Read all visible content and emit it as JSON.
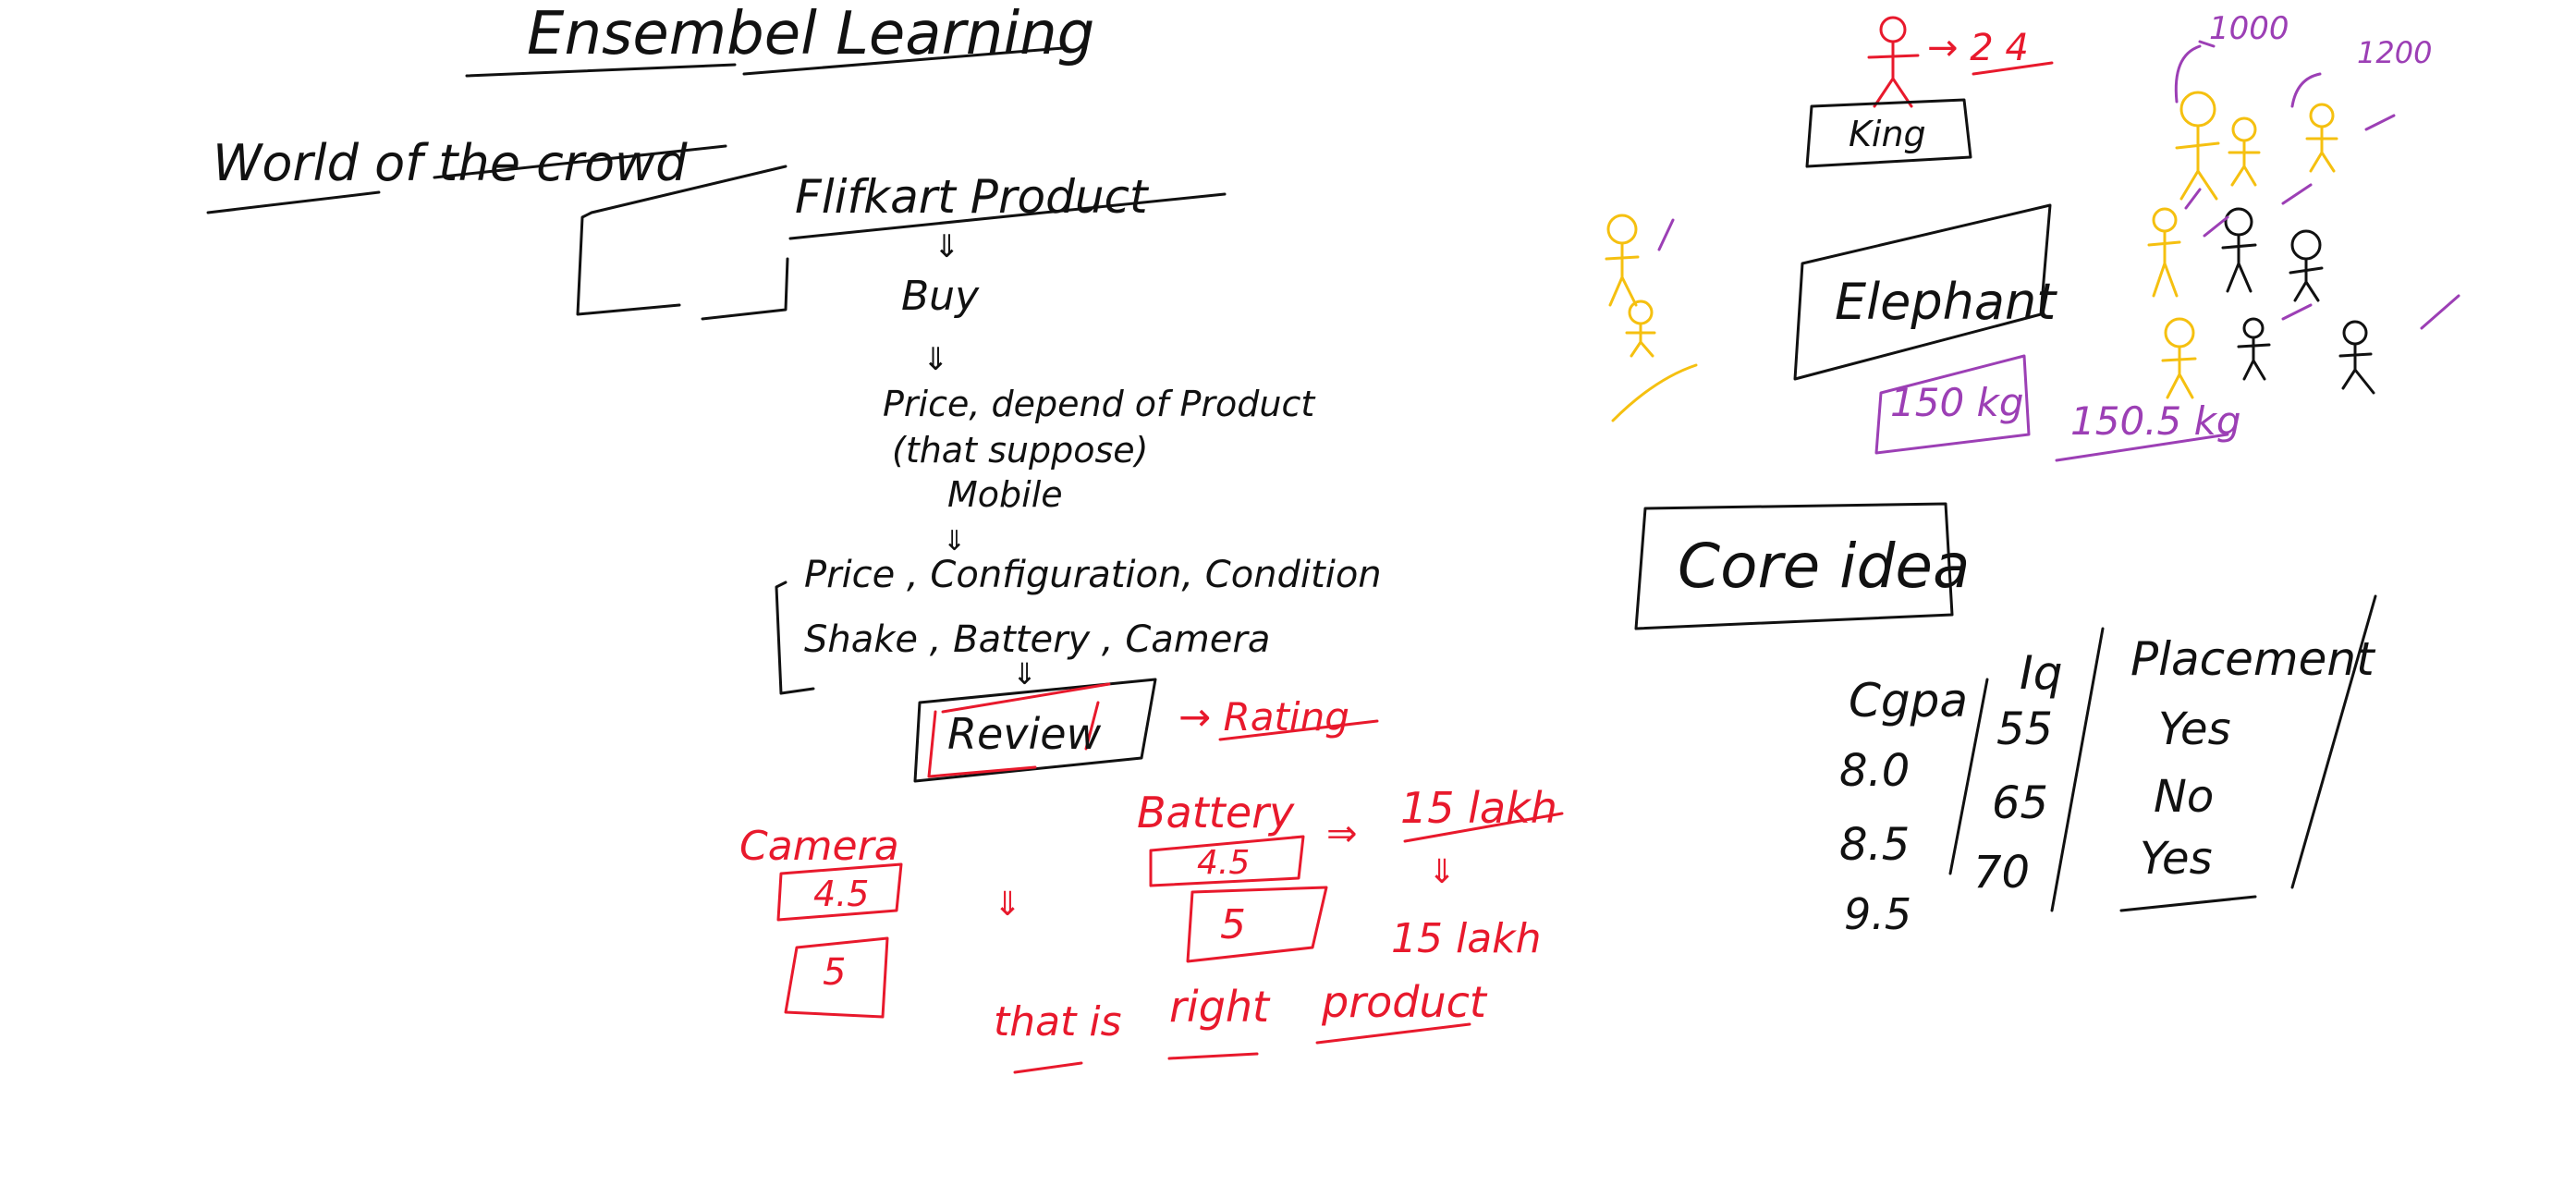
{
  "left": {
    "title": "Ensembel Learning",
    "subtitle": "World of the crowd",
    "product": "Flifkart Product",
    "buy": "Buy",
    "price_line1": "Price, depend of Product",
    "price_line2": "(that suppose)",
    "mobile": "Mobile",
    "features_line1": "Price , Configuration, Condition",
    "features_line2": "Shake , Battery , Camera",
    "review": "Review",
    "rating": "→ Rating",
    "camera": "Camera",
    "camera_rating": "4.5",
    "camera_rating2": "5",
    "battery": "Battery",
    "battery_rating": "4.5",
    "battery_rating2": "5",
    "price1": "15 lakh",
    "price2": "15 lakh",
    "conclusion_1": "that is",
    "conclusion_2": "right",
    "conclusion_3": "product"
  },
  "right": {
    "king": "King",
    "count": "→ 2 4",
    "count_1000": "1000",
    "count_1200": "1200",
    "elephant": "Elephant",
    "weight_guess": "150 kg",
    "weight_crowd": "150.5 kg",
    "core_idea": "Core idea",
    "table": {
      "headers": [
        "Cgpa",
        "Iq",
        "Placement"
      ],
      "rows": [
        [
          "8.0",
          "55",
          "Yes"
        ],
        [
          "8.5",
          "65",
          "No"
        ],
        [
          "9.5",
          "70",
          "Yes"
        ]
      ]
    }
  }
}
